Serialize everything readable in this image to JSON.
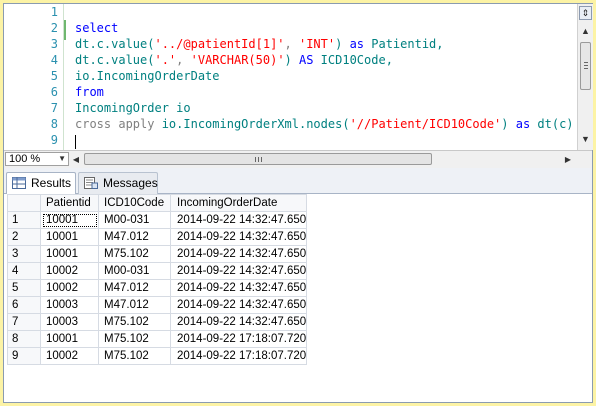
{
  "editor": {
    "line_numbers": [
      "1",
      "2",
      "3",
      "4",
      "5",
      "6",
      "7",
      "8",
      "9"
    ],
    "lines": [
      [],
      [
        {
          "t": "select",
          "c": "kw"
        }
      ],
      [
        {
          "t": "dt.c.value(",
          "c": "id"
        },
        {
          "t": "'../@patientId[1]'",
          "c": "str"
        },
        {
          "t": ", ",
          "c": "grey"
        },
        {
          "t": "'INT'",
          "c": "str"
        },
        {
          "t": ") ",
          "c": "id"
        },
        {
          "t": "as",
          "c": "kw"
        },
        {
          "t": " Patientid,",
          "c": "id"
        }
      ],
      [
        {
          "t": "dt.c.value(",
          "c": "id"
        },
        {
          "t": "'.'",
          "c": "str"
        },
        {
          "t": ", ",
          "c": "grey"
        },
        {
          "t": "'VARCHAR(50)'",
          "c": "str"
        },
        {
          "t": ") ",
          "c": "id"
        },
        {
          "t": "AS",
          "c": "kw"
        },
        {
          "t": " ICD10Code,",
          "c": "id"
        }
      ],
      [
        {
          "t": "io.IncomingOrderDate",
          "c": "id"
        }
      ],
      [
        {
          "t": "from",
          "c": "kw"
        }
      ],
      [
        {
          "t": "IncomingOrder io",
          "c": "id"
        }
      ],
      [
        {
          "t": "cross apply",
          "c": "grey"
        },
        {
          "t": " io.IncomingOrderXml.nodes(",
          "c": "id"
        },
        {
          "t": "'//Patient/ICD10Code'",
          "c": "str"
        },
        {
          "t": ") ",
          "c": "id"
        },
        {
          "t": "as",
          "c": "kw"
        },
        {
          "t": " dt(c)",
          "c": "id"
        }
      ],
      []
    ]
  },
  "zoom": {
    "value": "100 %"
  },
  "tabs": {
    "results": "Results",
    "messages": "Messages"
  },
  "grid": {
    "columns": [
      "Patientid",
      "ICD10Code",
      "IncomingOrderDate"
    ],
    "rows": [
      [
        "1",
        "10001",
        "M00-031",
        "2014-09-22 14:32:47.650"
      ],
      [
        "2",
        "10001",
        "M47.012",
        "2014-09-22 14:32:47.650"
      ],
      [
        "3",
        "10001",
        "M75.102",
        "2014-09-22 14:32:47.650"
      ],
      [
        "4",
        "10002",
        "M00-031",
        "2014-09-22 14:32:47.650"
      ],
      [
        "5",
        "10002",
        "M47.012",
        "2014-09-22 14:32:47.650"
      ],
      [
        "6",
        "10003",
        "M47.012",
        "2014-09-22 14:32:47.650"
      ],
      [
        "7",
        "10003",
        "M75.102",
        "2014-09-22 14:32:47.650"
      ],
      [
        "8",
        "10001",
        "M75.102",
        "2014-09-22 17:18:07.720"
      ],
      [
        "9",
        "10002",
        "M75.102",
        "2014-09-22 17:18:07.720"
      ]
    ]
  },
  "icons": {
    "results_tab": "grid-table-icon",
    "messages_tab": "messages-document-icon",
    "split": "split-pane-icon",
    "scroll_up": "arrow-up-icon",
    "scroll_down": "arrow-down-icon",
    "scroll_left": "arrow-left-icon",
    "scroll_right": "arrow-right-icon",
    "zoom_dropdown": "chevron-down-icon"
  },
  "colors": {
    "keyword": "#0000ff",
    "string": "#ff0000",
    "identifier": "#008080",
    "operator": "#808080",
    "line_number": "#2b91af"
  }
}
